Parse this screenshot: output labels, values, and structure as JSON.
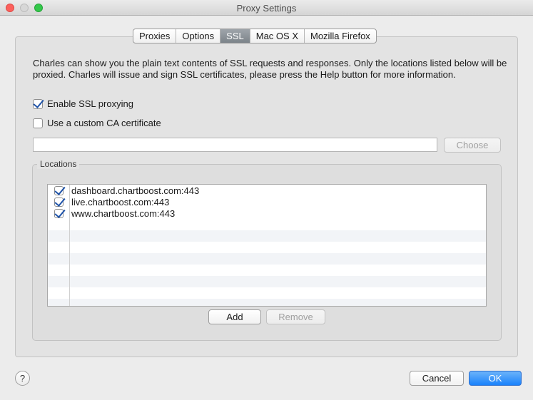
{
  "window": {
    "title": "Proxy Settings"
  },
  "tabs": [
    {
      "label": "Proxies",
      "active": false
    },
    {
      "label": "Options",
      "active": false
    },
    {
      "label": "SSL",
      "active": true
    },
    {
      "label": "Mac OS X",
      "active": false
    },
    {
      "label": "Mozilla Firefox",
      "active": false
    }
  ],
  "ssl": {
    "description": "Charles can show you the plain text contents of SSL requests and responses. Only the locations listed below will be proxied. Charles will issue and sign SSL certificates, please press the Help button for more information.",
    "enable_ssl_label": "Enable SSL proxying",
    "enable_ssl_checked": true,
    "custom_ca_label": "Use a custom CA certificate",
    "custom_ca_checked": false,
    "certificate_path_value": "",
    "choose_label": "Choose"
  },
  "locations": {
    "group_label": "Locations",
    "rows": [
      {
        "checked": true,
        "host": "dashboard.chartboost.com:443"
      },
      {
        "checked": true,
        "host": "live.chartboost.com:443"
      },
      {
        "checked": true,
        "host": "www.chartboost.com:443"
      }
    ],
    "add_label": "Add",
    "remove_label": "Remove"
  },
  "footer": {
    "help_label": "?",
    "cancel_label": "Cancel",
    "ok_label": "OK"
  },
  "colors": {
    "active_tab": "#8a9096",
    "primary_button": "#1a82fb",
    "checkbox_mark": "#1f53a8"
  }
}
